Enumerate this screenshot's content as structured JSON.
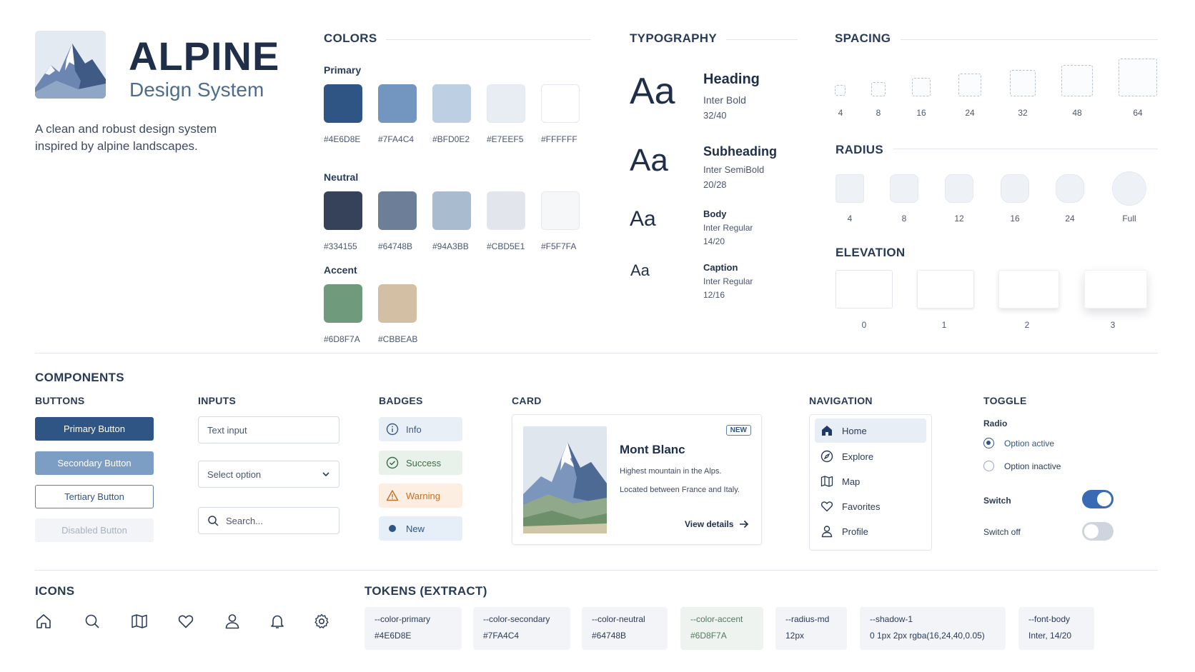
{
  "brand": {
    "title": "ALPINE",
    "subtitle": "Design System",
    "description_line1": "A clean and robust design system",
    "description_line2": "inspired by alpine landscapes."
  },
  "colors": {
    "heading": "COLORS",
    "groups": [
      {
        "label": "Primary",
        "swatches": [
          {
            "hex": "#4E6D8E",
            "color": "#2f5584"
          },
          {
            "hex": "#7FA4C4",
            "color": "#7296c0"
          },
          {
            "hex": "#BFD0E2",
            "color": "#bccfe3"
          },
          {
            "hex": "#E7EEF5",
            "color": "#e8edf3"
          },
          {
            "hex": "#FFFFFF",
            "color": "#ffffff"
          }
        ]
      },
      {
        "label": "Neutral",
        "swatches": [
          {
            "hex": "#334155",
            "color": "#354259"
          },
          {
            "hex": "#64748B",
            "color": "#6c7e98"
          },
          {
            "hex": "#94A3BB",
            "color": "#a9bbcf"
          },
          {
            "hex": "#CBD5E1",
            "color": "#e2e6ec"
          },
          {
            "hex": "#F5F7FA",
            "color": "#f6f7f9"
          }
        ]
      },
      {
        "label": "Accent",
        "swatches": [
          {
            "hex": "#6D8F7A",
            "color": "#6f9a7c"
          },
          {
            "hex": "#CBBEAB",
            "color": "#d3c0a4"
          }
        ]
      }
    ]
  },
  "typography": {
    "heading": "TYPOGRAPHY",
    "sample": "Aa",
    "styles": [
      {
        "name": "Heading",
        "font": "Inter Bold",
        "size": "32/40"
      },
      {
        "name": "Subheading",
        "font": "Inter SemiBold",
        "size": "20/28"
      },
      {
        "name": "Body",
        "font": "Inter Regular",
        "size": "14/20"
      },
      {
        "name": "Caption",
        "font": "Inter Regular",
        "size": "12/16"
      }
    ]
  },
  "spacing": {
    "heading": "SPACING",
    "values": [
      "4",
      "8",
      "16",
      "24",
      "32",
      "48",
      "64"
    ]
  },
  "radius": {
    "heading": "RADIUS",
    "values": [
      "4",
      "8",
      "12",
      "16",
      "24",
      "Full"
    ]
  },
  "elevation": {
    "heading": "ELEVATION",
    "values": [
      "0",
      "1",
      "2",
      "3"
    ]
  },
  "components": {
    "heading": "COMPONENTS",
    "buttons": {
      "heading": "BUTTONS",
      "primary": "Primary Button",
      "secondary": "Secondary Button",
      "tertiary": "Tertiary Button",
      "disabled": "Disabled Button"
    },
    "inputs": {
      "heading": "INPUTS",
      "text_placeholder": "Text input",
      "select_value": "Select option",
      "search_placeholder": "Search..."
    },
    "badges": {
      "heading": "BADGES",
      "info": "Info",
      "success": "Success",
      "warning": "Warning",
      "new": "New"
    },
    "card": {
      "heading": "CARD",
      "badge": "NEW",
      "title": "Mont Blanc",
      "line1": "Highest mountain in the Alps.",
      "line2": "Located between France and Italy.",
      "link": "View details"
    },
    "navigation": {
      "heading": "NAVIGATION",
      "items": [
        "Home",
        "Explore",
        "Map",
        "Favorites",
        "Profile"
      ]
    },
    "toggle": {
      "heading": "TOGGLE",
      "radio_label": "Radio",
      "option_active": "Option active",
      "option_inactive": "Option inactive",
      "switch_label": "Switch",
      "switch_off_label": "Switch off"
    }
  },
  "icons": {
    "heading": "ICONS",
    "list": [
      "home-icon",
      "search-icon",
      "map-icon",
      "heart-icon",
      "user-icon",
      "bell-icon",
      "gear-icon"
    ]
  },
  "tokens": {
    "heading": "TOKENS (EXTRACT)",
    "items": [
      {
        "name": "--color-primary",
        "value": "#4E6D8E"
      },
      {
        "name": "--color-secondary",
        "value": "#7FA4C4"
      },
      {
        "name": "--color-neutral",
        "value": "#64748B"
      },
      {
        "name": "--color-accent",
        "value": "#6D8F7A"
      },
      {
        "name": "--radius-md",
        "value": "12px"
      },
      {
        "name": "--shadow-1",
        "value": "0 1px 2px rgba(16,24,40,0.05)"
      },
      {
        "name": "--font-body",
        "value": "Inter, 14/20"
      }
    ]
  }
}
